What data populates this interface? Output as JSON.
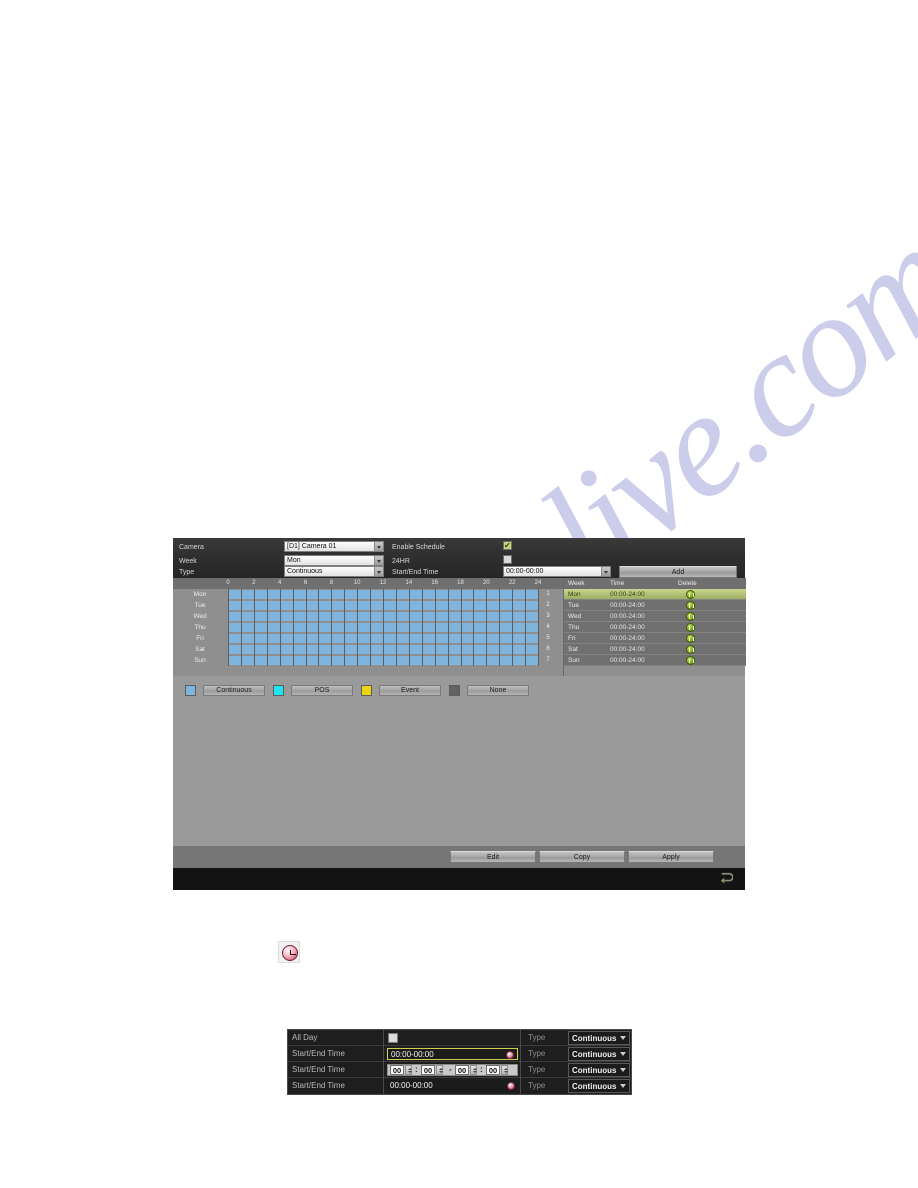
{
  "watermark": {
    "text": "manualslive.com"
  },
  "schedule_panel": {
    "fields": {
      "camera_label": "Camera",
      "camera_value": "[D1] Camera 01",
      "enable_schedule_label": "Enable Schedule",
      "enable_schedule_checked": true,
      "week_label": "Week",
      "week_value": "Mon",
      "all_day_24hr_label": "24HR",
      "all_day_24hr_checked": false,
      "type_label": "Type",
      "type_value": "Continuous",
      "start_end_time_label": "Start/End Time",
      "start_end_time_value": "00:00-00:00",
      "add_label": "Add"
    },
    "grid": {
      "hour_ticks": [
        "0",
        "2",
        "4",
        "6",
        "8",
        "10",
        "12",
        "14",
        "16",
        "18",
        "20",
        "22",
        "24"
      ],
      "days": [
        "Mon",
        "Tue",
        "Wed",
        "Thu",
        "Fri",
        "Sat",
        "Sun"
      ],
      "day_numbers": [
        "1",
        "2",
        "3",
        "4",
        "5",
        "6",
        "7"
      ]
    },
    "list": {
      "headers": [
        "Week",
        "Time",
        "Delete"
      ],
      "rows": [
        {
          "week": "Mon",
          "time": "00:00-24:00",
          "selected": true
        },
        {
          "week": "Tue",
          "time": "00:00-24:00",
          "selected": false
        },
        {
          "week": "Wed",
          "time": "00:00-24:00",
          "selected": false
        },
        {
          "week": "Thu",
          "time": "00:00-24:00",
          "selected": false
        },
        {
          "week": "Fri",
          "time": "00:00-24:00",
          "selected": false
        },
        {
          "week": "Sat",
          "time": "00:00-24:00",
          "selected": false
        },
        {
          "week": "Sun",
          "time": "00:00-24:00",
          "selected": false
        }
      ]
    },
    "legend": [
      {
        "label": "Continuous",
        "color": "#7fb4dc"
      },
      {
        "label": "POS",
        "color": "#1ee6f0"
      },
      {
        "label": "Event",
        "color": "#ead40f"
      },
      {
        "label": "None",
        "color": "#636363"
      }
    ],
    "footer_buttons": [
      "Edit",
      "Copy",
      "Apply"
    ],
    "back_icon": "back-arrow-icon"
  },
  "clock_icon": {
    "name": "clock-icon"
  },
  "edit_dialog": {
    "rows": [
      {
        "label": "All Day",
        "kind": "checkbox",
        "checked": false,
        "type_label": "Type",
        "type_value": "Continuous"
      },
      {
        "label": "Start/End Time",
        "kind": "time",
        "value": "00:00-00:00",
        "type_label": "Type",
        "type_value": "Continuous",
        "focused": true
      },
      {
        "label": "Start/End Time",
        "kind": "spinner",
        "value": [
          "00",
          "00",
          "00",
          "00"
        ],
        "type_label": "Type",
        "type_value": "Continuous"
      },
      {
        "label": "Start/End Time",
        "kind": "time",
        "value": "00:00-00:00",
        "type_label": "Type",
        "type_value": "Continuous"
      }
    ]
  }
}
